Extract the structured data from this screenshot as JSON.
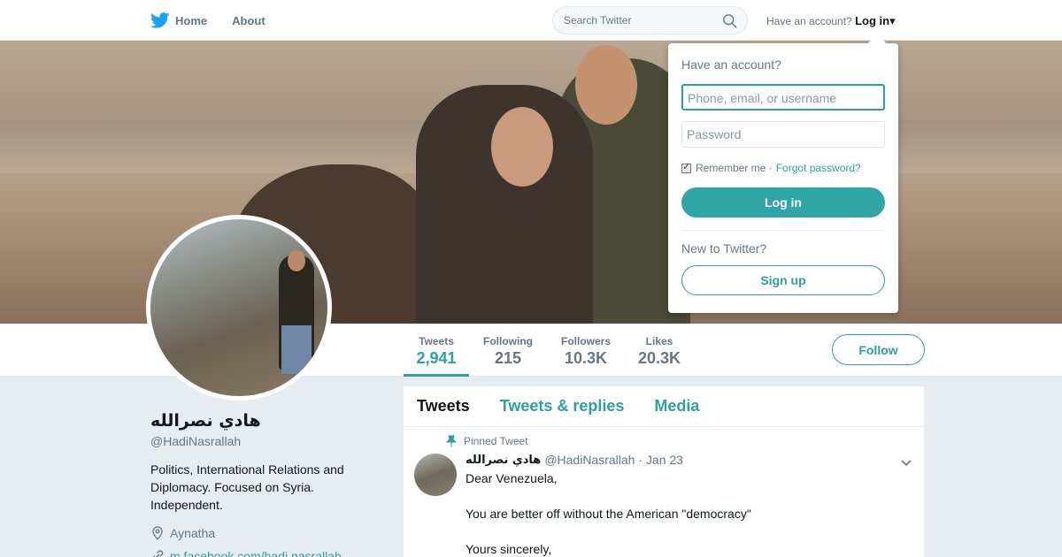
{
  "nav": {
    "home_label": "Home",
    "about_label": "About",
    "search_placeholder": "Search Twitter",
    "have_account": "Have an account?",
    "login_label": "Log in"
  },
  "stats": [
    {
      "label": "Tweets",
      "value": "2,941"
    },
    {
      "label": "Following",
      "value": "215"
    },
    {
      "label": "Followers",
      "value": "10.3K"
    },
    {
      "label": "Likes",
      "value": "20.3K"
    }
  ],
  "follow_label": "Follow",
  "profile": {
    "name": "هادي نصرالله",
    "handle": "@HadiNasrallah",
    "bio": "Politics, International Relations and Diplomacy. Focused on Syria. Independent.",
    "location": "Aynatha",
    "link": "m.facebook.com/hadi.nasrallah"
  },
  "timeline": {
    "tabs": [
      "Tweets",
      "Tweets & replies",
      "Media"
    ],
    "pinned_label": "Pinned Tweet",
    "tweet": {
      "name": "هادي نصرالله",
      "handle": "@HadiNasrallah",
      "date": "· Jan 23",
      "lines": [
        "Dear Venezuela,",
        "",
        "You are better off without the American \"democracy\"",
        "",
        "Yours sincerely,"
      ]
    }
  },
  "login_dropdown": {
    "title": "Have an account?",
    "username_placeholder": "Phone, email, or username",
    "password_placeholder": "Password",
    "remember_me": "Remember me ·",
    "forgot_password": "Forgot password?",
    "login_button": "Log in",
    "new_to_twitter": "New to Twitter?",
    "signup_button": "Sign up"
  },
  "colors": {
    "accent": "#2f9fa6",
    "brand": "#1da1f2"
  }
}
